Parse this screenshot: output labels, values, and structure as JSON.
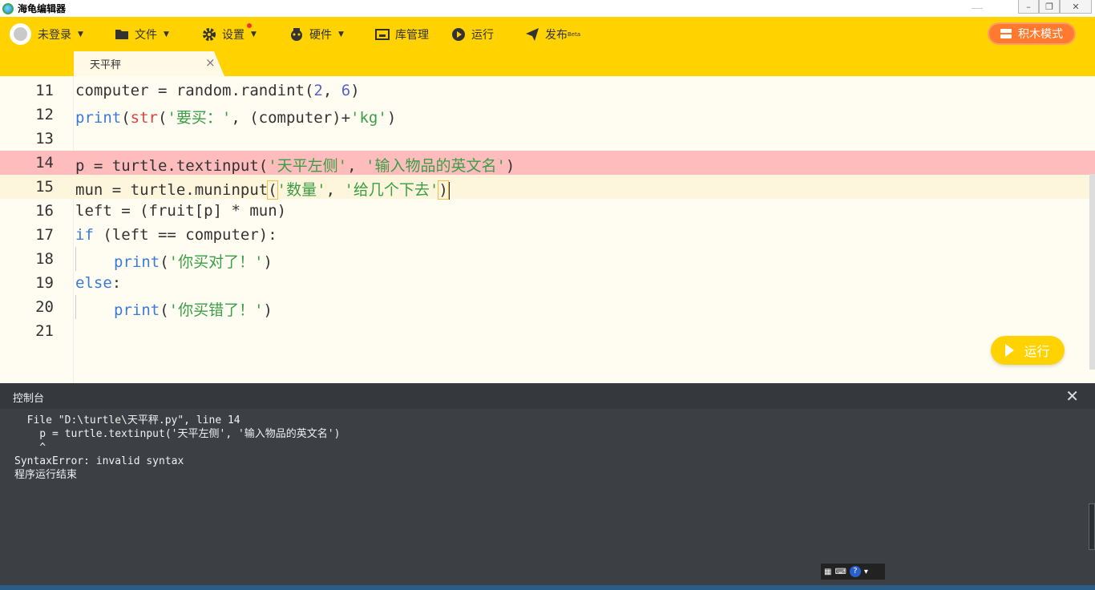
{
  "window": {
    "title": "海龟编辑器"
  },
  "toolbar": {
    "login": "未登录",
    "file": "文件",
    "settings": "设置",
    "hardware": "硬件",
    "library": "库管理",
    "run": "运行",
    "publish": "发布",
    "publish_badge": "Beta",
    "block_mode": "积木模式"
  },
  "tab": {
    "label": "天平秤",
    "close": "×"
  },
  "editor": {
    "line_numbers": [
      "11",
      "12",
      "13",
      "14",
      "15",
      "16",
      "17",
      "18",
      "19",
      "20",
      "21"
    ],
    "lines": {
      "l11_a": "computer = random.randint(",
      "l11_n1": "2",
      "l11_b": ", ",
      "l11_n2": "6",
      "l11_c": ")",
      "l12_kw": "print",
      "l12_a": "(",
      "l12_fn": "str",
      "l12_b": "(",
      "l12_s1": "'要买：'",
      "l12_c": ", (computer)+",
      "l12_s2": "'kg'",
      "l12_d": ")",
      "l14_a": "p = turtle.textinput(",
      "l14_s1": "'天平左侧'",
      "l14_b": ", ",
      "l14_s2": "'输入物品的英文名'",
      "l14_c": ")",
      "l15_a": "mun = turtle.muninput",
      "l15_b": "(",
      "l15_s1": "'数量'",
      "l15_c": ", ",
      "l15_s2": "'给几个下去'",
      "l15_d": ")",
      "l16": "left = (fruit[p] * mun)",
      "l17_kw": "if",
      "l17_a": " (left == computer):",
      "l18_kw": "print",
      "l18_a": "(",
      "l18_s": "'你买对了！'",
      "l18_b": ")",
      "l19_kw": "else",
      "l19_a": ":",
      "l20_kw": "print",
      "l20_a": "(",
      "l20_s": "'你买错了！'",
      "l20_b": ")"
    },
    "run_button": "运行"
  },
  "console": {
    "title": "控制台",
    "close": "✕",
    "output": "  File \"D:\\turtle\\天平秤.py\", line 14\n    p = turtle.textinput('天平左侧', '输入物品的英文名')\n    ^\nSyntaxError: invalid syntax\n程序运行结束"
  },
  "colors": {
    "toolbar_bg": "#ffd200",
    "error_line": "#ffbcbc",
    "keyword": "#3b7bd6",
    "string": "#3a9e46",
    "number": "#5b5fcf",
    "console_bg": "#3c3f44",
    "accent_orange": "#ff7a2e"
  },
  "icons": [
    "app-logo-icon",
    "avatar-icon",
    "folder-icon",
    "gear-icon",
    "hardware-icon",
    "library-icon",
    "play-circle-icon",
    "send-icon",
    "blocks-icon",
    "close-icon",
    "play-icon"
  ]
}
